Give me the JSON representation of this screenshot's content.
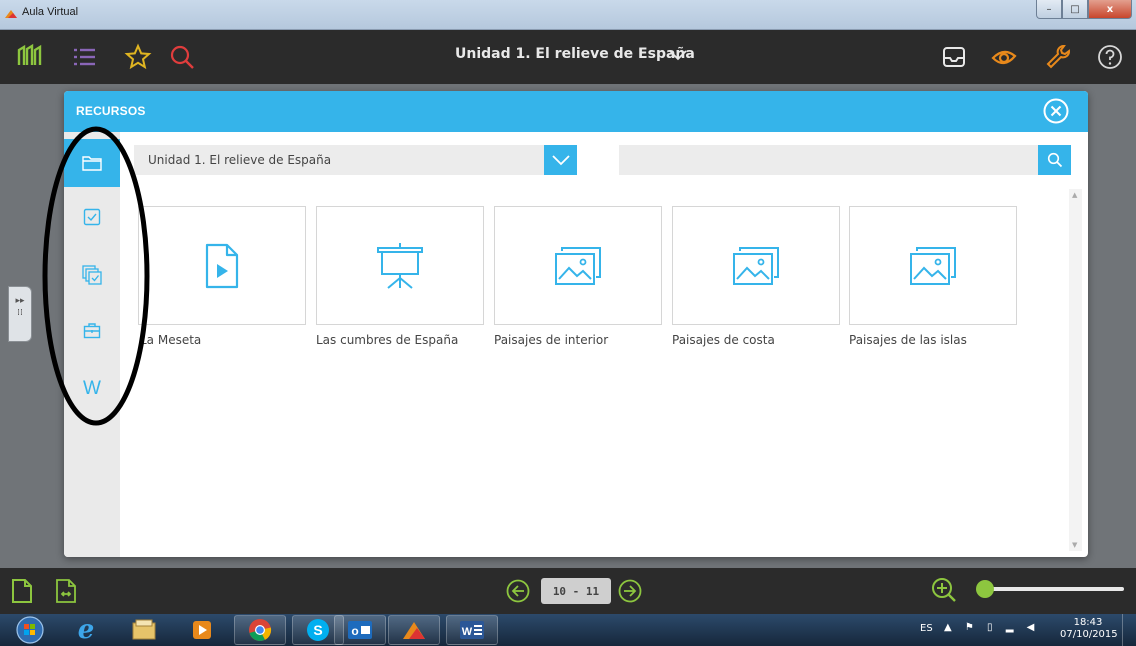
{
  "window": {
    "title": "Aula Virtual",
    "minimize": "–",
    "maximize": "□",
    "close": "x"
  },
  "toolbar": {
    "unit_title": "Unidad 1. El relieve de España",
    "icons": [
      "logo-icon",
      "list-icon",
      "star-icon",
      "search-icon",
      "inbox-icon",
      "eye-icon",
      "wrench-icon",
      "help-icon"
    ]
  },
  "colors": {
    "accent": "#35b4ea",
    "toolbar_bg": "#2b2b2b",
    "sidebar_bg": "#eaeaea",
    "green": "#8dc63f",
    "red": "#e03d3d",
    "yellow": "#e0b521",
    "orange": "#e8891b"
  },
  "modal": {
    "title": "RECURSOS",
    "sidebar_items": [
      {
        "icon": "folder-icon",
        "active": true
      },
      {
        "icon": "checkbox-icon",
        "active": false
      },
      {
        "icon": "multi-check-icon",
        "active": false
      },
      {
        "icon": "briefcase-icon",
        "active": false
      },
      {
        "icon": "w-icon",
        "active": false,
        "text": "W"
      }
    ],
    "filter": {
      "unit_select_value": "Unidad 1. El relieve de España",
      "search_value": ""
    },
    "resources": [
      {
        "label": "La Meseta",
        "icon": "video-file-icon"
      },
      {
        "label": "Las cumbres de España",
        "icon": "presentation-icon"
      },
      {
        "label": "Paisajes de interior",
        "icon": "gallery-icon"
      },
      {
        "label": "Paisajes de costa",
        "icon": "gallery-icon"
      },
      {
        "label": "Paisajes de las islas",
        "icon": "gallery-icon"
      }
    ]
  },
  "bottom": {
    "page_indicator": "10 - 11"
  },
  "taskbar": {
    "lang": "ES",
    "time": "18:43",
    "date": "07/10/2015"
  }
}
